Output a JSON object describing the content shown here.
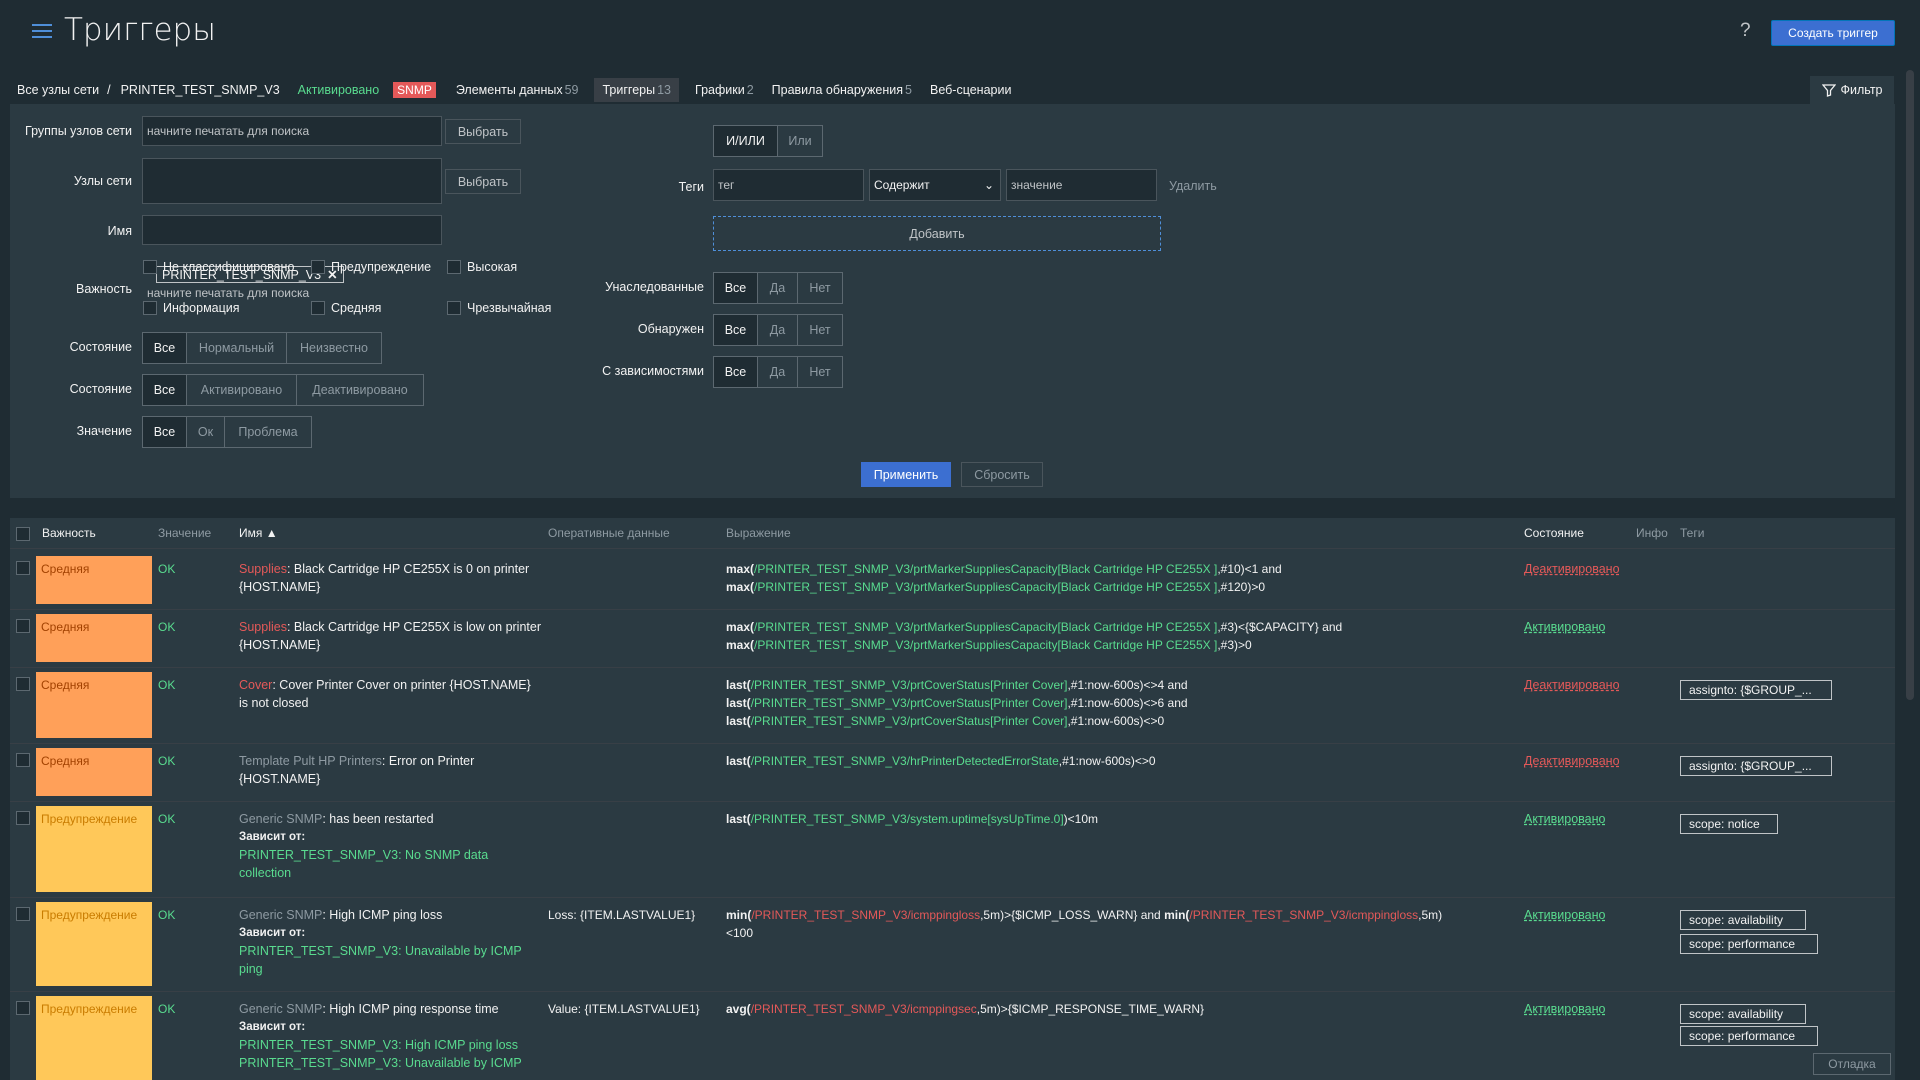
{
  "header": {
    "title": "Триггеры",
    "help": "?",
    "create_button": "Создать триггер"
  },
  "breadcrumb": {
    "all_hosts": "Все узлы сети",
    "separator": "/",
    "host": "PRINTER_TEST_SNMP_V3",
    "status": "Активировано",
    "snmp": "SNMP",
    "tabs": [
      {
        "label": "Элементы данных",
        "count": "59"
      },
      {
        "label": "Триггеры",
        "count": "13"
      },
      {
        "label": "Графики",
        "count": "2"
      },
      {
        "label": "Правила обнаружения",
        "count": "5"
      },
      {
        "label": "Веб-сценарии",
        "count": ""
      }
    ],
    "filter": "Фильтр"
  },
  "filter": {
    "host_groups_label": "Группы узлов сети",
    "host_groups_placeholder": "начните печатать для поиска",
    "select": "Выбрать",
    "hosts_label": "Узлы сети",
    "host_chip": "PRINTER_TEST_SNMP_V3",
    "hosts_placeholder": "начните печатать для поиска",
    "name_label": "Имя",
    "severity_label": "Важность",
    "severities": [
      "Не классифицировано",
      "Предупреждение",
      "Высокая",
      "Информация",
      "Средняя",
      "Чрезвычайная"
    ],
    "state_label": "Состояние",
    "state_options": [
      "Все",
      "Нормальный",
      "Неизвестно"
    ],
    "status_label": "Состояние",
    "status_options": [
      "Все",
      "Активировано",
      "Деактивировано"
    ],
    "value_label": "Значение",
    "value_options": [
      "Все",
      "Ок",
      "Проблема"
    ],
    "tags_eval": [
      "И/ИЛИ",
      "Или"
    ],
    "tags_label": "Теги",
    "tag_placeholder": "тег",
    "tag_operator": "Содержит",
    "tag_value_placeholder": "значение",
    "remove": "Удалить",
    "add": "Добавить",
    "inherited_label": "Унаследованные",
    "discovered_label": "Обнаружен",
    "dependencies_label": "С зависимостями",
    "yesno": [
      "Все",
      "Да",
      "Нет"
    ],
    "apply": "Применить",
    "reset": "Сбросить"
  },
  "table": {
    "headers": [
      "Важность",
      "Значение",
      "Имя ▲",
      "Оперативные данные",
      "Выражение",
      "Состояние",
      "Инфо",
      "Теги"
    ],
    "rows": [
      {
        "severity": "Средняя",
        "value": "OK",
        "name_prefix": "Supplies",
        "name": ": Black Cartridge HP CE255X is 0 on printer {HOST.NAME}",
        "expr": [
          [
            "max(",
            "/PRINTER_TEST_SNMP_V3/prtMarkerSuppliesCapacity[Black Cartridge HP CE255X ]",
            ",#10)<1 and"
          ],
          [
            "max(",
            "/PRINTER_TEST_SNMP_V3/prtMarkerSuppliesCapacity[Black Cartridge HP CE255X ]",
            ",#120)>0"
          ]
        ],
        "state": "Деактивировано"
      },
      {
        "severity": "Средняя",
        "value": "OK",
        "name_prefix": "Supplies",
        "name": ": Black Cartridge HP CE255X is low on printer {HOST.NAME}",
        "expr": [
          [
            "max(",
            "/PRINTER_TEST_SNMP_V3/prtMarkerSuppliesCapacity[Black Cartridge HP CE255X ]",
            ",#3)<{$CAPACITY} and"
          ],
          [
            "max(",
            "/PRINTER_TEST_SNMP_V3/prtMarkerSuppliesCapacity[Black Cartridge HP CE255X ]",
            ",#3)>0"
          ]
        ],
        "state": "Активировано"
      },
      {
        "severity": "Средняя",
        "value": "OK",
        "name_prefix": "Cover",
        "name": ": Cover Printer Cover on printer {HOST.NAME} is not closed",
        "expr": [
          [
            "last(",
            "/PRINTER_TEST_SNMP_V3/prtCoverStatus[Printer Cover]",
            ",#1:now-600s)<>4 and"
          ],
          [
            "last(",
            "/PRINTER_TEST_SNMP_V3/prtCoverStatus[Printer Cover]",
            ",#1:now-600s)<>6 and"
          ],
          [
            "last(",
            "/PRINTER_TEST_SNMP_V3/prtCoverStatus[Printer Cover]",
            ",#1:now-600s)<>0"
          ]
        ],
        "state": "Деактивировано",
        "tags": [
          "assignto: {$GROUP_..."
        ]
      },
      {
        "severity": "Средняя",
        "value": "OK",
        "name_prefix": "Template Pult HP Printers",
        "name": ": Error on Printer {HOST.NAME}",
        "expr": [
          [
            "last(",
            "/PRINTER_TEST_SNMP_V3/hrPrinterDetectedErrorState",
            ",#1:now-600s)<>0"
          ]
        ],
        "state": "Деактивировано",
        "tags": [
          "assignto: {$GROUP_..."
        ]
      },
      {
        "severity": "Предупреждение",
        "value": "OK",
        "name_prefix": "Generic SNMP",
        "name": ": has been restarted",
        "depends_label": "Зависит от:",
        "depends": [
          "PRINTER_TEST_SNMP_V3: No SNMP data collection"
        ],
        "expr": [
          [
            "last(",
            "/PRINTER_TEST_SNMP_V3/system.uptime[sysUpTime.0]",
            ")<10m"
          ]
        ],
        "state": "Активировано",
        "tags": [
          "scope: notice"
        ]
      },
      {
        "severity": "Предупреждение",
        "value": "OK",
        "name_prefix": "Generic SNMP",
        "name": ": High ICMP ping loss",
        "depends_label": "Зависит от:",
        "depends": [
          "PRINTER_TEST_SNMP_V3: Unavailable by ICMP ping"
        ],
        "opdata": "Loss: {ITEM.LASTVALUE1}",
        "expr_a": [
          "min(",
          "/PRINTER_TEST_SNMP_V3/icmppingloss",
          ",5m)>{$ICMP_LOSS_WARN} and ",
          "min(",
          "/PRINTER_TEST_SNMP_V3/icmppingloss",
          ",5m)",
          "<100"
        ],
        "state": "Активировано",
        "tags": [
          "scope: availability",
          "scope: performance"
        ]
      },
      {
        "severity": "Предупреждение",
        "value": "OK",
        "name_prefix": "Generic SNMP",
        "name": ": High ICMP ping response time",
        "depends_label": "Зависит от:",
        "depends": [
          "PRINTER_TEST_SNMP_V3: High ICMP ping loss",
          "PRINTER_TEST_SNMP_V3: Unavailable by ICMP"
        ],
        "opdata": "Value: {ITEM.LASTVALUE1}",
        "expr_b": [
          "avg(",
          "/PRINTER_TEST_SNMP_V3/icmppingsec",
          ",5m)>{$ICMP_RESPONSE_TIME_WARN}"
        ],
        "state": "Активировано",
        "tags": [
          "scope: availability",
          "scope: performance"
        ]
      }
    ]
  },
  "debug_button": "Отладка"
}
